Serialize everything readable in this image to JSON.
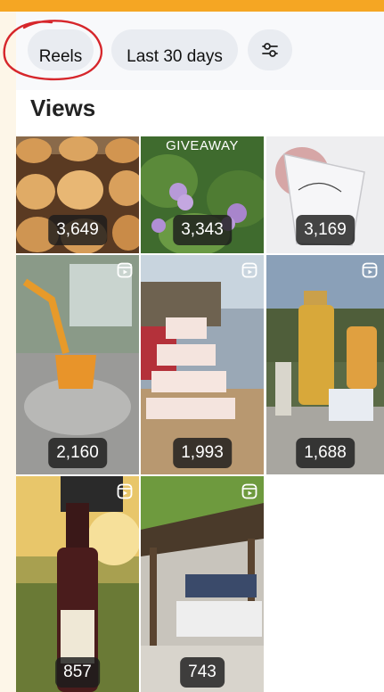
{
  "filters": {
    "reels_label": "Reels",
    "range_label": "Last 30 days",
    "settings_icon": "sliders-icon"
  },
  "section": {
    "title": "Views"
  },
  "reels": [
    {
      "views": "3,649",
      "is_reel": false,
      "icon": "reel-icon"
    },
    {
      "views": "3,343",
      "is_reel": false,
      "icon": "reel-icon",
      "overlay_title": "GIVEAWAY"
    },
    {
      "views": "3,169",
      "is_reel": false,
      "icon": "reel-icon"
    },
    {
      "views": "2,160",
      "is_reel": true,
      "icon": "reel-icon"
    },
    {
      "views": "1,993",
      "is_reel": true,
      "icon": "reel-icon"
    },
    {
      "views": "1,688",
      "is_reel": true,
      "icon": "reel-icon"
    },
    {
      "views": "857",
      "is_reel": true,
      "icon": "reel-icon"
    },
    {
      "views": "743",
      "is_reel": true,
      "icon": "reel-icon"
    }
  ],
  "colors": {
    "accent": "#f5a623",
    "annotation": "#d6262b",
    "badge_bg": "#1c1c1c"
  }
}
